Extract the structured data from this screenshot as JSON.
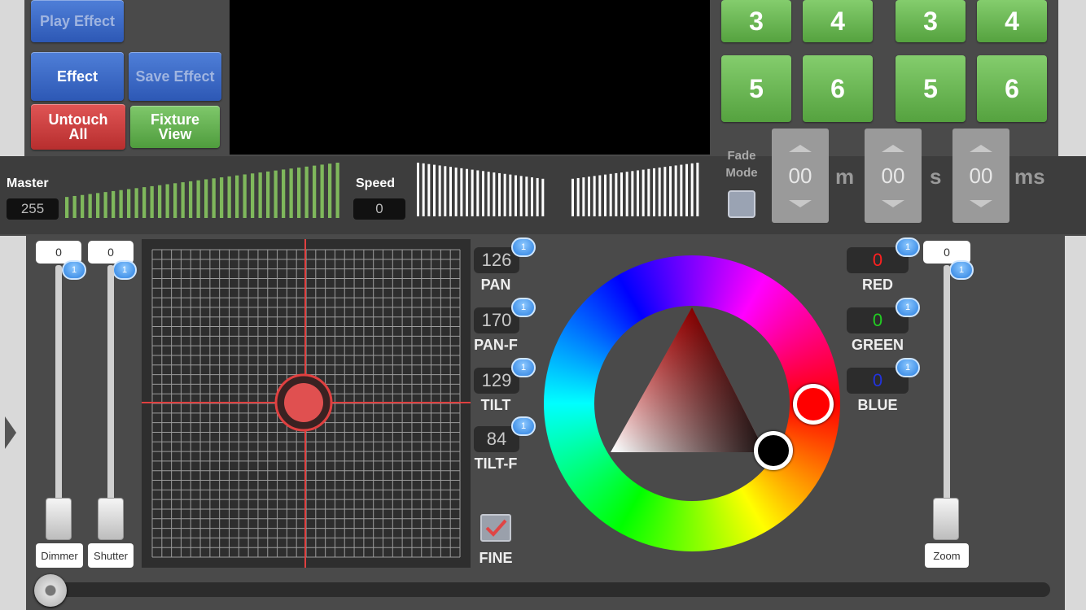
{
  "buttons": {
    "play_effect": "Play Effect",
    "effect": "Effect",
    "save_effect": "Save Effect",
    "untouch_all": "Untouch\nAll",
    "fixture_view": "Fixture\nView"
  },
  "scene_grid": {
    "left": [
      "3",
      "4",
      "5",
      "6"
    ],
    "right": [
      "3",
      "4",
      "5",
      "6"
    ]
  },
  "master": {
    "label": "Master",
    "value": "255",
    "level": 1.0
  },
  "speed": {
    "label": "Speed",
    "value": "0",
    "level": 0.5
  },
  "fade": {
    "label_line1": "Fade",
    "label_line2": "Mode",
    "minutes": "00",
    "minutes_unit": "m",
    "seconds": "00",
    "seconds_unit": "s",
    "millis": "00",
    "millis_unit": "ms"
  },
  "sliders": {
    "dimmer": {
      "value": "0",
      "label": "Dimmer",
      "badge": "1"
    },
    "shutter": {
      "value": "0",
      "label": "Shutter",
      "badge": "1"
    },
    "zoom": {
      "value": "0",
      "label": "Zoom",
      "badge": "1"
    }
  },
  "channels": [
    {
      "value": "126",
      "label": "PAN"
    },
    {
      "value": "170",
      "label": "PAN-F"
    },
    {
      "value": "129",
      "label": "TILT"
    },
    {
      "value": "84",
      "label": "TILT-F"
    }
  ],
  "fine": {
    "label": "FINE",
    "checked": true
  },
  "colors": [
    {
      "value": "0",
      "label": "RED",
      "color": "#ff2020"
    },
    {
      "value": "0",
      "label": "GREEN",
      "color": "#22cc22"
    },
    {
      "value": "0",
      "label": "BLUE",
      "color": "#2233dd"
    }
  ],
  "badge_text": "1",
  "accent": {
    "crosshair": "#e04040",
    "handle": "#e05050"
  }
}
